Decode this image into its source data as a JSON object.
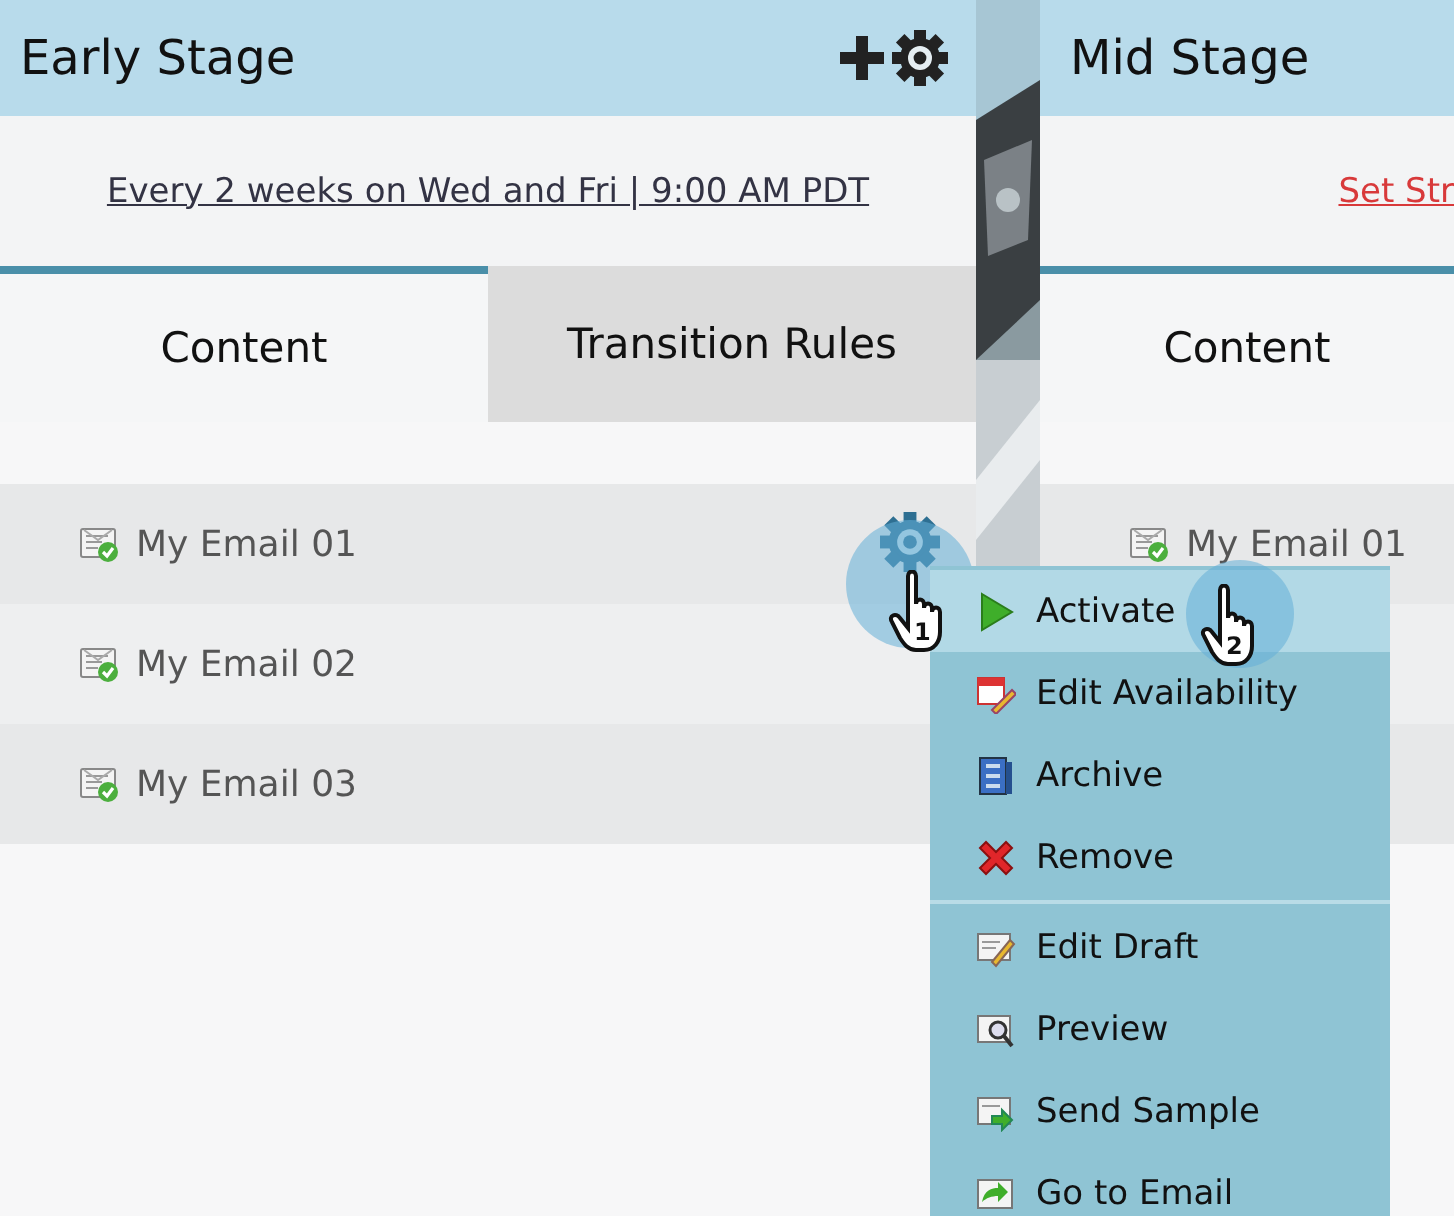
{
  "streams": [
    {
      "title": "Early Stage",
      "schedule": {
        "text": "Every 2 weeks on Wed and Fri | 9:00 AM PDT",
        "kind": "set"
      },
      "tabs": [
        {
          "label": "Content",
          "selected": true
        },
        {
          "label": "Transition Rules",
          "selected": false
        }
      ],
      "rows": [
        {
          "name": "My Email 01",
          "active": true
        },
        {
          "name": "My Email 02",
          "active": false
        },
        {
          "name": "My Email 03",
          "active": false
        }
      ],
      "header_actions": true
    },
    {
      "title": "Mid Stage",
      "schedule": {
        "text": "Set Str",
        "kind": "unset"
      },
      "tabs": [
        {
          "label": "Content",
          "selected": true
        }
      ],
      "rows": [
        {
          "name": "My Email 01",
          "active": false
        }
      ],
      "header_actions": false
    }
  ],
  "menu": {
    "groups": [
      [
        {
          "label": "Activate",
          "kind": "activate",
          "selected": true
        },
        {
          "label": "Edit Availability",
          "kind": "availability",
          "selected": false
        },
        {
          "label": "Archive",
          "kind": "archive",
          "selected": false
        },
        {
          "label": "Remove",
          "kind": "remove",
          "selected": false
        }
      ],
      [
        {
          "label": "Edit Draft",
          "kind": "edit",
          "selected": false
        },
        {
          "label": "Preview",
          "kind": "preview",
          "selected": false
        },
        {
          "label": "Send Sample",
          "kind": "send",
          "selected": false
        },
        {
          "label": "Go to Email",
          "kind": "goto",
          "selected": false
        }
      ]
    ]
  },
  "cursor_steps": [
    "1",
    "2"
  ]
}
